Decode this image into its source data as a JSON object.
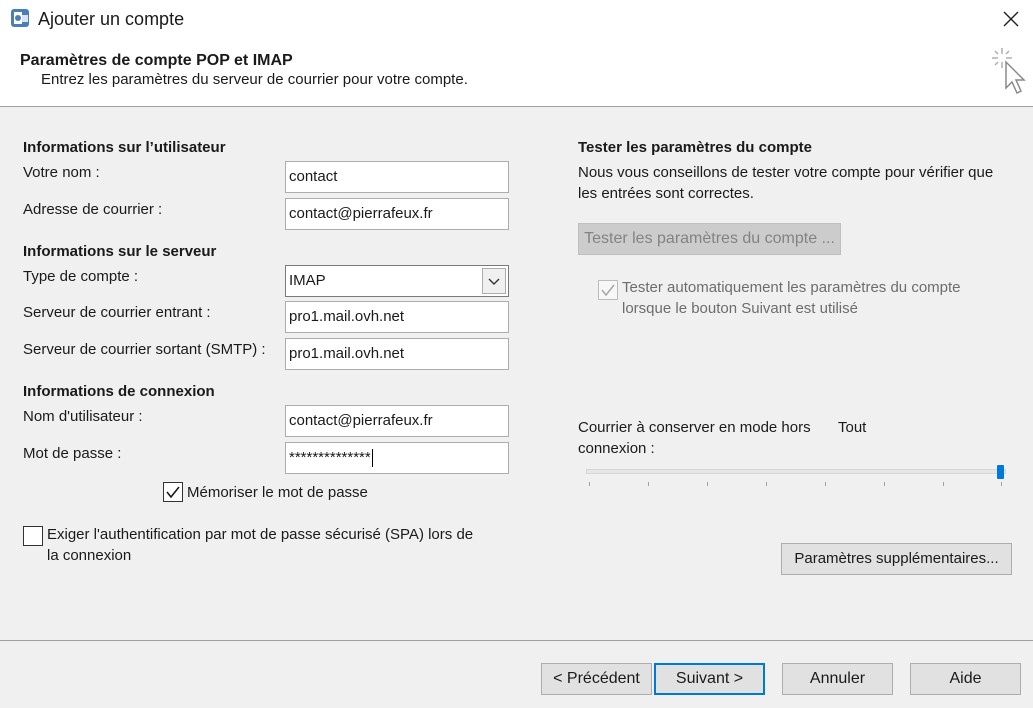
{
  "window": {
    "title": "Ajouter un compte"
  },
  "header": {
    "heading": "Paramètres de compte POP et IMAP",
    "subheading": "Entrez les paramètres du serveur de courrier pour votre compte."
  },
  "user_info": {
    "section_title": "Informations sur l’utilisateur",
    "name_label": "Votre nom :",
    "name_value": "contact",
    "email_label": "Adresse de courrier :",
    "email_value": "contact@pierrafeux.fr"
  },
  "server_info": {
    "section_title": "Informations sur le serveur",
    "account_type_label": "Type de compte :",
    "account_type_value": "IMAP",
    "incoming_label": "Serveur de courrier entrant :",
    "incoming_value": "pro1.mail.ovh.net",
    "outgoing_label": "Serveur de courrier sortant (SMTP) :",
    "outgoing_value": "pro1.mail.ovh.net"
  },
  "login_info": {
    "section_title": "Informations de connexion",
    "username_label": "Nom d'utilisateur :",
    "username_value": "contact@pierrafeux.fr",
    "password_label": "Mot de passe :",
    "password_value": "**************",
    "remember_label": "Mémoriser le mot de passe",
    "remember_checked": true,
    "spa_label_1": "Exiger l'authentification par mot de passe sécurisé (SPA) lors de",
    "spa_label_2": "la connexion",
    "spa_checked": false
  },
  "test_settings": {
    "section_title": "Tester les paramètres du compte",
    "description_1": "Nous vous conseillons de tester votre compte pour vérifier que",
    "description_2": "les entrées sont correctes.",
    "test_button": "Tester les paramètres du compte ...",
    "auto_test_label_1": "Tester automatiquement les paramètres du compte",
    "auto_test_label_2": "lorsque le bouton Suivant est utilisé",
    "auto_test_checked": true
  },
  "offline": {
    "label_1": "Courrier à conserver en mode hors",
    "label_2": "connexion :",
    "value": "Tout",
    "slider_level": 1.0
  },
  "more_settings_button": "Paramètres supplémentaires...",
  "footer": {
    "back": "< Précédent",
    "next": "Suivant >",
    "cancel": "Annuler",
    "help": "Aide"
  },
  "colors": {
    "accent": "#0078d7",
    "background": "#f0f0f0"
  }
}
